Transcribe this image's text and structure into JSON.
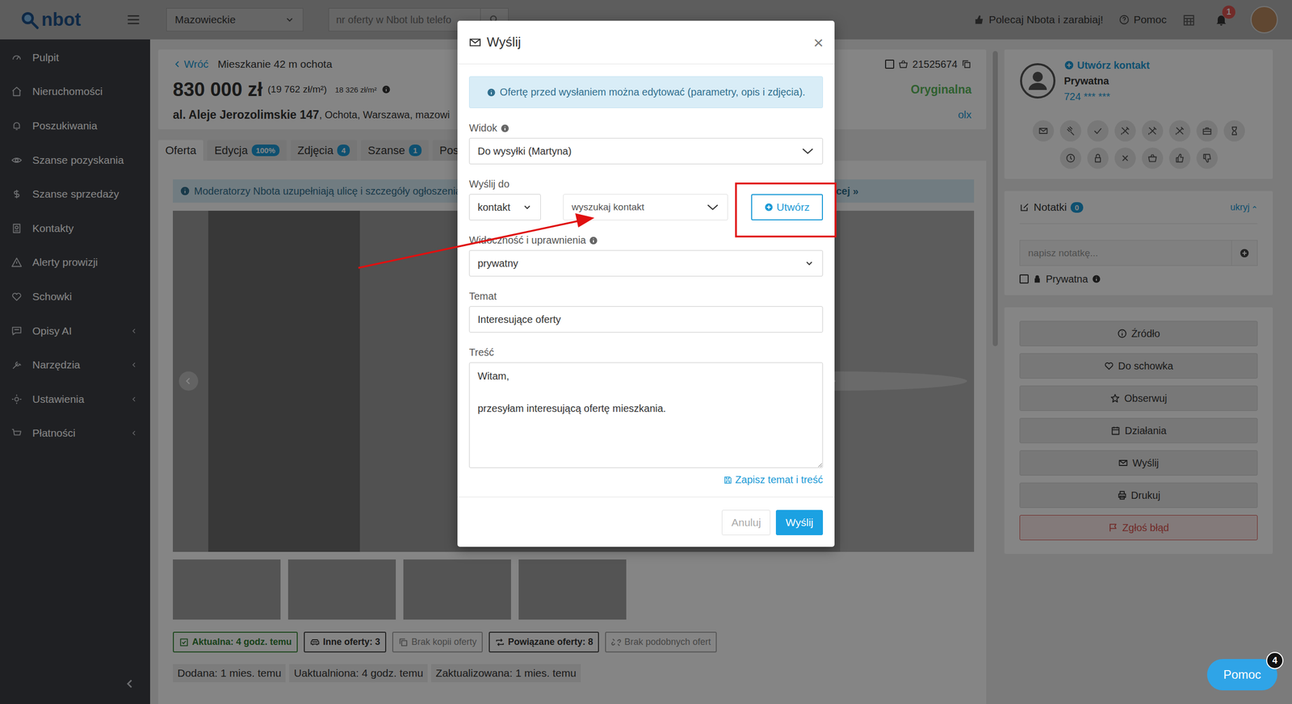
{
  "topbar": {
    "logo": "nbot",
    "region": "Mazowieckie",
    "search_placeholder": "nr oferty w Nbot lub telefo",
    "referral": "Polecaj Nbota i zarabiaj!",
    "help": "Pomoc",
    "notifications": "1"
  },
  "sidebar": {
    "items": [
      {
        "label": "Pulpit",
        "expandable": false,
        "selected": false
      },
      {
        "label": "Nieruchomości",
        "expandable": false,
        "selected": false
      },
      {
        "label": "Poszukiwania",
        "expandable": false,
        "selected": false
      },
      {
        "label": "Szanse pozyskania",
        "expandable": false,
        "selected": false
      },
      {
        "label": "Szanse sprzedaży",
        "expandable": false,
        "selected": false
      },
      {
        "label": "Kontakty",
        "expandable": false,
        "selected": false
      },
      {
        "label": "Alerty prowizji",
        "expandable": false,
        "selected": false
      },
      {
        "label": "Schowki",
        "expandable": false,
        "selected": false
      },
      {
        "label": "Opisy AI",
        "expandable": true,
        "selected": false
      },
      {
        "label": "Narzędzia",
        "expandable": true,
        "selected": false
      },
      {
        "label": "Ustawienia",
        "expandable": true,
        "selected": false
      },
      {
        "label": "Płatności",
        "expandable": true,
        "selected": false
      }
    ]
  },
  "offer": {
    "back": "Wróć",
    "title": "Mieszkanie 42 m ochota",
    "price": "830 000 zł",
    "price_per_m2": "(19 762 zł/m²)",
    "avg_per_m2": "18 326 zł/m²",
    "street": "al. Aleje Jerozolimskie 147",
    "location": ", Ochota, Warszawa, mazowi",
    "id": "21525674",
    "status": "Oryginalna",
    "source": "olx"
  },
  "tabs": [
    {
      "label": "Oferta",
      "selected": true
    },
    {
      "label": "Edycja",
      "badge": "100%",
      "selected": false
    },
    {
      "label": "Zdjęcia",
      "badge": "4",
      "selected": false
    },
    {
      "label": "Szanse",
      "badge": "1",
      "selected": false
    },
    {
      "label": "Posz",
      "selected": false
    }
  ],
  "notice": {
    "text": "Moderatorzy Nbota uzupełniają ulicę i szczegóły ogłoszenia w",
    "link": "cej »"
  },
  "gallery": {
    "thumbnails": [
      {
        "selected": false
      },
      {
        "selected": false
      },
      {
        "selected": false
      },
      {
        "selected": false
      }
    ]
  },
  "chips": [
    {
      "label": "Aktualna: 4 godz. temu",
      "kind": "success"
    },
    {
      "label": "Inne oferty: 3",
      "kind": "default"
    },
    {
      "label": "Brak kopii oferty",
      "kind": "disabled"
    },
    {
      "label": "Powiązane oferty: 8",
      "kind": "default"
    },
    {
      "label": "Brak podobnych ofert",
      "kind": "disabled"
    }
  ],
  "dates": [
    "Dodana: 1 mies. temu",
    "Uaktualniona: 4 godz. temu",
    "Zaktualizowana: 1 mies. temu"
  ],
  "contact": {
    "create": "Utwórz kontakt",
    "type": "Prywatna",
    "phone": "724 *** ***"
  },
  "notes": {
    "title": "Notatki",
    "count": "0",
    "toggle": "ukryj",
    "placeholder": "napisz notatkę...",
    "private_label": "Prywatna",
    "private_checked": false
  },
  "actions": [
    {
      "label": "Źródło",
      "kind": "default"
    },
    {
      "label": "Do schowka",
      "kind": "default"
    },
    {
      "label": "Obserwuj",
      "kind": "default"
    },
    {
      "label": "Działania",
      "kind": "default"
    },
    {
      "label": "Wyślij",
      "kind": "default"
    },
    {
      "label": "Drukuj",
      "kind": "default"
    },
    {
      "label": "Zgłoś błąd",
      "kind": "danger"
    }
  ],
  "help_button": {
    "label": "Pomoc",
    "badge": "4"
  },
  "modal": {
    "title": "Wyślij",
    "close": "×",
    "notice": "Ofertę przed wysłaniem można edytować (parametry, opis i zdjęcia).",
    "view": {
      "label": "Widok",
      "value": "Do wysyłki (Martyna)"
    },
    "recipient": {
      "label": "Wyślij do",
      "type": "kontakt",
      "search_placeholder": "wyszukaj kontakt",
      "create": "Utwórz"
    },
    "visibility": {
      "label": "Widoczność i uprawnienia",
      "value": "prywatny"
    },
    "subject": {
      "label": "Temat",
      "value": "Interesujące oferty"
    },
    "body": {
      "label": "Treść",
      "value": "Witam,\n\nprzesyłam interesującą ofertę mieszkania."
    },
    "save_link": "Zapisz temat i treść",
    "buttons": [
      {
        "label": "Anuluj",
        "kind": "default",
        "disabled": true
      },
      {
        "label": "Wyślij",
        "kind": "primary",
        "disabled": false
      }
    ]
  }
}
